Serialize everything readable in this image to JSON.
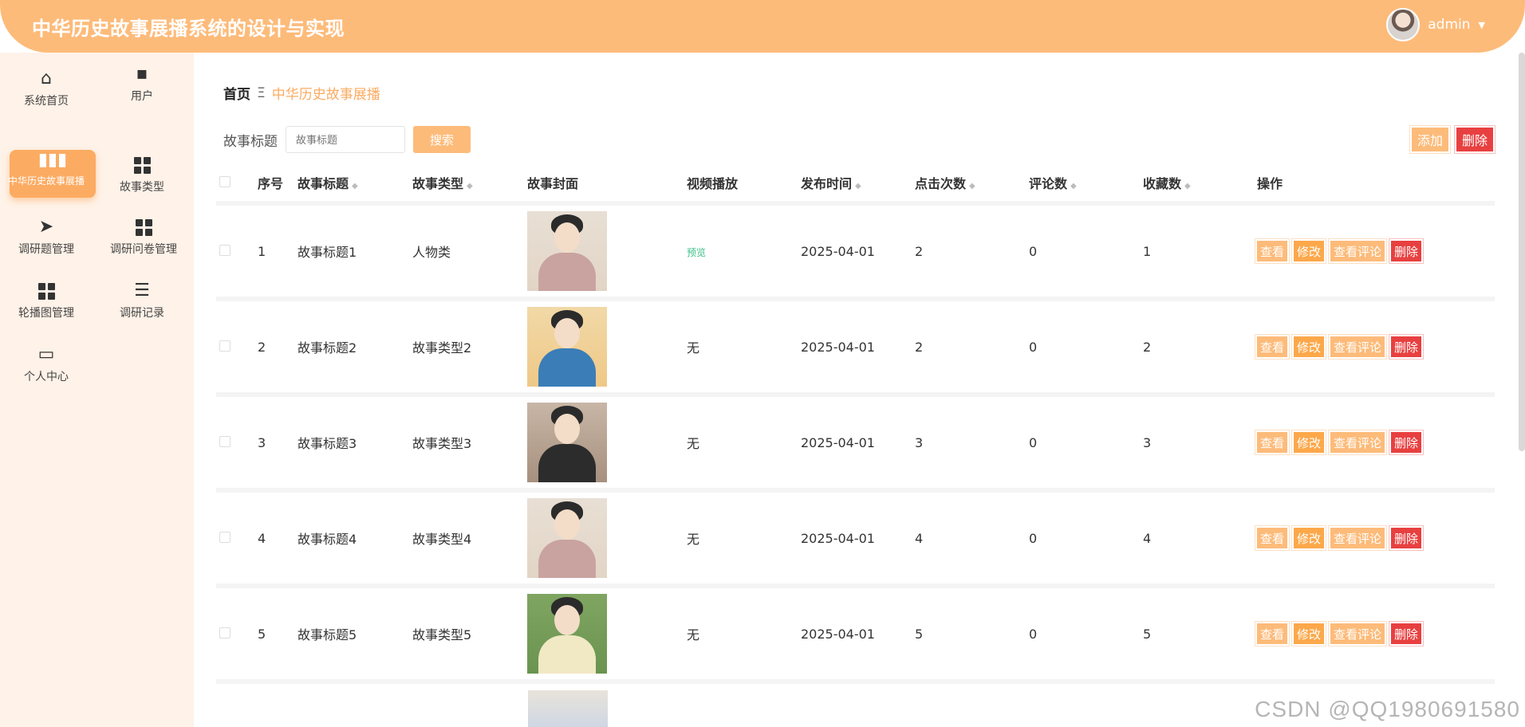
{
  "header": {
    "title": "中华历史故事展播系统的设计与实现",
    "username": "admin"
  },
  "sidebar": {
    "items": [
      {
        "label": "系统首页",
        "icon": "home-icon"
      },
      {
        "label": "用户",
        "icon": "chat-icon"
      },
      {
        "label": "中华历史故事展播",
        "icon": "bar-chart-icon"
      },
      {
        "label": "故事类型",
        "icon": "grid-icon"
      },
      {
        "label": "调研题管理",
        "icon": "paper-plane-icon"
      },
      {
        "label": "调研问卷管理",
        "icon": "grid-icon"
      },
      {
        "label": "轮播图管理",
        "icon": "grid-icon"
      },
      {
        "label": "调研记录",
        "icon": "list-icon"
      },
      {
        "label": "个人中心",
        "icon": "wallet-icon"
      }
    ]
  },
  "breadcrumb": {
    "home": "首页",
    "separator": "Ξ",
    "current": "中华历史故事展播"
  },
  "search": {
    "label": "故事标题",
    "placeholder": "故事标题",
    "button": "搜索"
  },
  "actions": {
    "add": "添加",
    "delete": "删除"
  },
  "table": {
    "headers": {
      "no": "序号",
      "title": "故事标题",
      "type": "故事类型",
      "cover": "故事封面",
      "video": "视频播放",
      "date": "发布时间",
      "hits": "点击次数",
      "comments": "评论数",
      "favorites": "收藏数",
      "ops": "操作"
    },
    "rows": [
      {
        "no": "1",
        "title": "故事标题1",
        "type": "人物类",
        "video": "预览",
        "date": "2025-04-01",
        "hits": "2",
        "comments": "0",
        "favorites": "1"
      },
      {
        "no": "2",
        "title": "故事标题2",
        "type": "故事类型2",
        "video": "无",
        "date": "2025-04-01",
        "hits": "2",
        "comments": "0",
        "favorites": "2"
      },
      {
        "no": "3",
        "title": "故事标题3",
        "type": "故事类型3",
        "video": "无",
        "date": "2025-04-01",
        "hits": "3",
        "comments": "0",
        "favorites": "3"
      },
      {
        "no": "4",
        "title": "故事标题4",
        "type": "故事类型4",
        "video": "无",
        "date": "2025-04-01",
        "hits": "4",
        "comments": "0",
        "favorites": "4"
      },
      {
        "no": "5",
        "title": "故事标题5",
        "type": "故事类型5",
        "video": "无",
        "date": "2025-04-01",
        "hits": "5",
        "comments": "0",
        "favorites": "5"
      }
    ],
    "row_ops": {
      "view": "查看",
      "edit": "修改",
      "comments": "查看评论",
      "delete": "删除"
    }
  },
  "watermark": "CSDN @QQ1980691580",
  "colors": {
    "accent": "#fdbb7a",
    "sidebar_bg": "#fff2e8",
    "danger": "#e84040",
    "preview": "#3cbf86"
  }
}
